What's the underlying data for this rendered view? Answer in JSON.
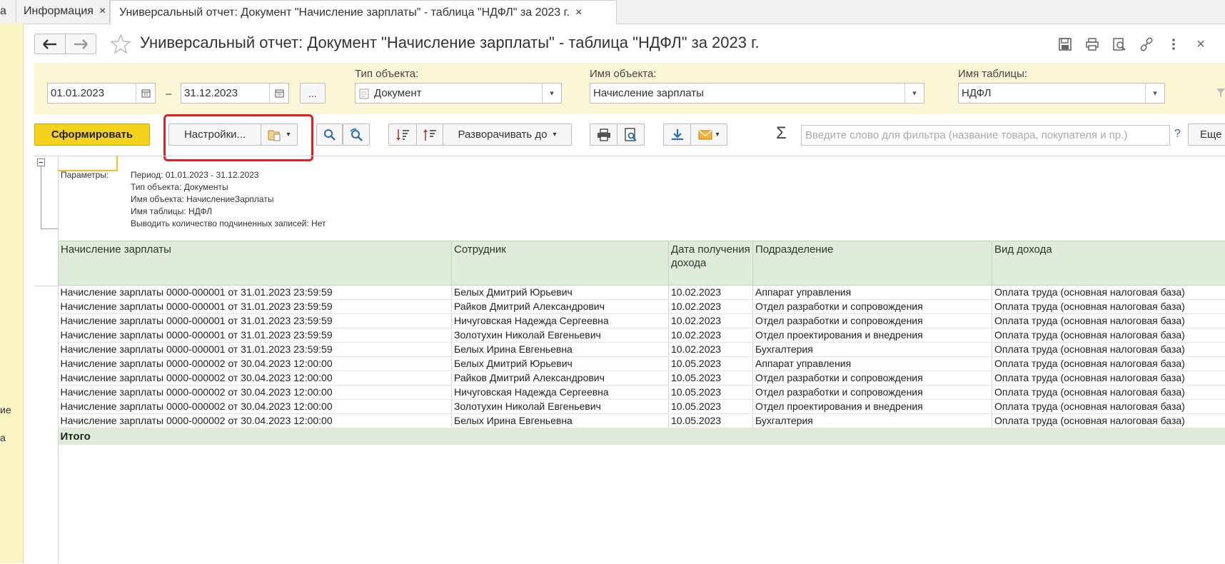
{
  "tabs": {
    "partial_label": "а",
    "info_label": "Информация",
    "report_label": "Универсальный отчет: Документ \"Начисление зарплаты\" - таблица \"НДФЛ\" за 2023 г.",
    "close_glyph": "×"
  },
  "sidebar": {
    "frag1": "ие",
    "frag2": "а"
  },
  "window": {
    "title": "Универсальный отчет: Документ \"Начисление зарплаты\" - таблица \"НДФЛ\" за 2023 г.",
    "close_glyph": "×"
  },
  "filters": {
    "date_from": "01.01.2023",
    "date_dash": "–",
    "date_to": "31.12.2023",
    "ellipsis": "...",
    "object_type_label": "Тип объекта:",
    "object_type_value": "Документ",
    "object_name_label": "Имя объекта:",
    "object_name_value": "Начисление зарплаты",
    "table_name_label": "Имя таблицы:",
    "table_name_value": "НДФЛ"
  },
  "toolbar": {
    "generate_label": "Сформировать",
    "settings_label": "Настройки...",
    "expand_label": "Разворачивать до",
    "search_placeholder": "Введите слово для фильтра (название товара, покупателя и пр.)",
    "help_label": "?",
    "more_label": "Еще",
    "sum_glyph": "Σ"
  },
  "parameters": {
    "heading": "Параметры:",
    "lines": [
      "Период: 01.01.2023 - 31.12.2023",
      "Тип объекта: Документы",
      "Имя объекта: НачислениеЗарплаты",
      "Имя таблицы: НДФЛ",
      "Выводить количество подчиненных записей: Нет"
    ]
  },
  "table": {
    "columns": [
      "Начисление зарплаты",
      "Сотрудник",
      "Дата получения дохода",
      "Подразделение",
      "Вид дохода"
    ],
    "rows": [
      [
        "Начисление зарплаты 0000-000001 от 31.01.2023 23:59:59",
        "Белых Дмитрий Юрьевич",
        "10.02.2023",
        "Аппарат управления",
        "Оплата труда (основная налоговая база)"
      ],
      [
        "Начисление зарплаты 0000-000001 от 31.01.2023 23:59:59",
        "Райков Дмитрий Александрович",
        "10.02.2023",
        "Отдел разработки и сопровождения",
        "Оплата труда (основная налоговая база)"
      ],
      [
        "Начисление зарплаты 0000-000001 от 31.01.2023 23:59:59",
        "Ничуговская Надежда Сергеевна",
        "10.02.2023",
        "Отдел разработки и сопровождения",
        "Оплата труда (основная налоговая база)"
      ],
      [
        "Начисление зарплаты 0000-000001 от 31.01.2023 23:59:59",
        "Золотухин Николай Евгеньевич",
        "10.02.2023",
        "Отдел проектирования и внедрения",
        "Оплата труда (основная налоговая база)"
      ],
      [
        "Начисление зарплаты 0000-000001 от 31.01.2023 23:59:59",
        "Белых Ирина Евгеньевна",
        "10.02.2023",
        "Бухгалтерия",
        "Оплата труда (основная налоговая база)"
      ],
      [
        "Начисление зарплаты 0000-000002 от 30.04.2023 12:00:00",
        "Белых Дмитрий Юрьевич",
        "10.05.2023",
        "Аппарат управления",
        "Оплата труда (основная налоговая база)"
      ],
      [
        "Начисление зарплаты 0000-000002 от 30.04.2023 12:00:00",
        "Райков Дмитрий Александрович",
        "10.05.2023",
        "Отдел разработки и сопровождения",
        "Оплата труда (основная налоговая база)"
      ],
      [
        "Начисление зарплаты 0000-000002 от 30.04.2023 12:00:00",
        "Ничуговская Надежда Сергеевна",
        "10.05.2023",
        "Отдел разработки и сопровождения",
        "Оплата труда (основная налоговая база)"
      ],
      [
        "Начисление зарплаты 0000-000002 от 30.04.2023 12:00:00",
        "Золотухин Николай Евгеньевич",
        "10.05.2023",
        "Отдел проектирования и внедрения",
        "Оплата труда (основная налоговая база)"
      ],
      [
        "Начисление зарплаты 0000-000002 от 30.04.2023 12:00:00",
        "Белых Ирина Евгеньевна",
        "10.05.2023",
        "Бухгалтерия",
        "Оплата труда (основная налоговая база)"
      ]
    ],
    "total_label": "Итого"
  },
  "colors": {
    "accent_yellow": "#f5d21e",
    "filter_panel": "#fbf7d6",
    "header_green": "#deecd9",
    "highlight_red": "#e02020"
  }
}
